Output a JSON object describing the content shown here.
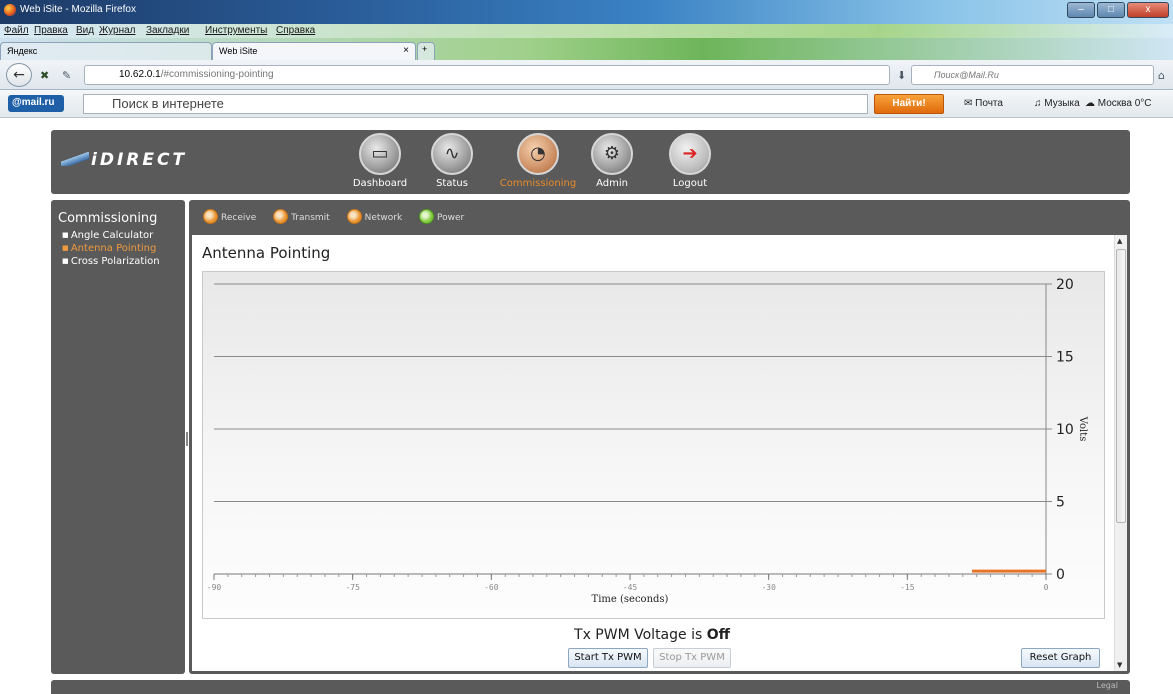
{
  "window": {
    "title": "Web iSite - Mozilla Firefox"
  },
  "menu": [
    "Файл",
    "Правка",
    "Вид",
    "Журнал",
    "Закладки",
    "Инструменты",
    "Справка"
  ],
  "tabs": [
    {
      "label": "Яндекс",
      "active": false
    },
    {
      "label": "Web iSite",
      "active": true
    }
  ],
  "address": {
    "host": "10.62.0.1",
    "path": "/#commissioning-pointing"
  },
  "search": {
    "placeholder": "Поиск@Mail.Ru"
  },
  "mailbar": {
    "logo": "@mail.ru",
    "search_placeholder": "Поиск в интернете",
    "find_label": "Найти!",
    "mail_label": "Почта",
    "music_label": "Музыка",
    "weather_label": "Москва 0°C"
  },
  "app": {
    "logo": "iDIRECT",
    "nav": [
      {
        "label": "Dashboard",
        "icon": "monitor-icon",
        "active": false
      },
      {
        "label": "Status",
        "icon": "graph-icon",
        "active": false
      },
      {
        "label": "Commissioning",
        "icon": "satellite-dish-icon",
        "active": true
      },
      {
        "label": "Admin",
        "icon": "gear-icon",
        "active": false
      },
      {
        "label": "Logout",
        "icon": "logout-icon",
        "active": false
      }
    ],
    "sidebar": {
      "heading": "Commissioning",
      "items": [
        {
          "label": "Angle Calculator",
          "active": false
        },
        {
          "label": "Antenna Pointing",
          "active": true
        },
        {
          "label": "Cross Polarization",
          "active": false
        }
      ]
    },
    "status": [
      {
        "label": "Receive",
        "color": "#e8932e"
      },
      {
        "label": "Transmit",
        "color": "#e8932e"
      },
      {
        "label": "Network",
        "color": "#e8932e"
      },
      {
        "label": "Power",
        "color": "#7fcb3d"
      }
    ],
    "page_title": "Antenna Pointing",
    "tx_prefix": "Tx PWM Voltage is ",
    "tx_state": "Off",
    "start_label": "Start Tx PWM",
    "stop_label": "Stop Tx PWM",
    "reset_label": "Reset Graph",
    "footer_link": "Legal"
  },
  "chart_data": {
    "type": "line",
    "xlabel": "Time (seconds)",
    "ylabel": "Volts",
    "xlim": [
      -90,
      0
    ],
    "ylim": [
      0,
      20
    ],
    "xticks": [
      -90,
      -75,
      -60,
      -45,
      -30,
      -15,
      0
    ],
    "yticks": [
      0,
      5,
      10,
      15,
      20
    ],
    "grid": true,
    "series": [
      {
        "color": "#e8742a",
        "x": [
          -8,
          0
        ],
        "y": [
          0.2,
          0.2
        ]
      }
    ]
  }
}
